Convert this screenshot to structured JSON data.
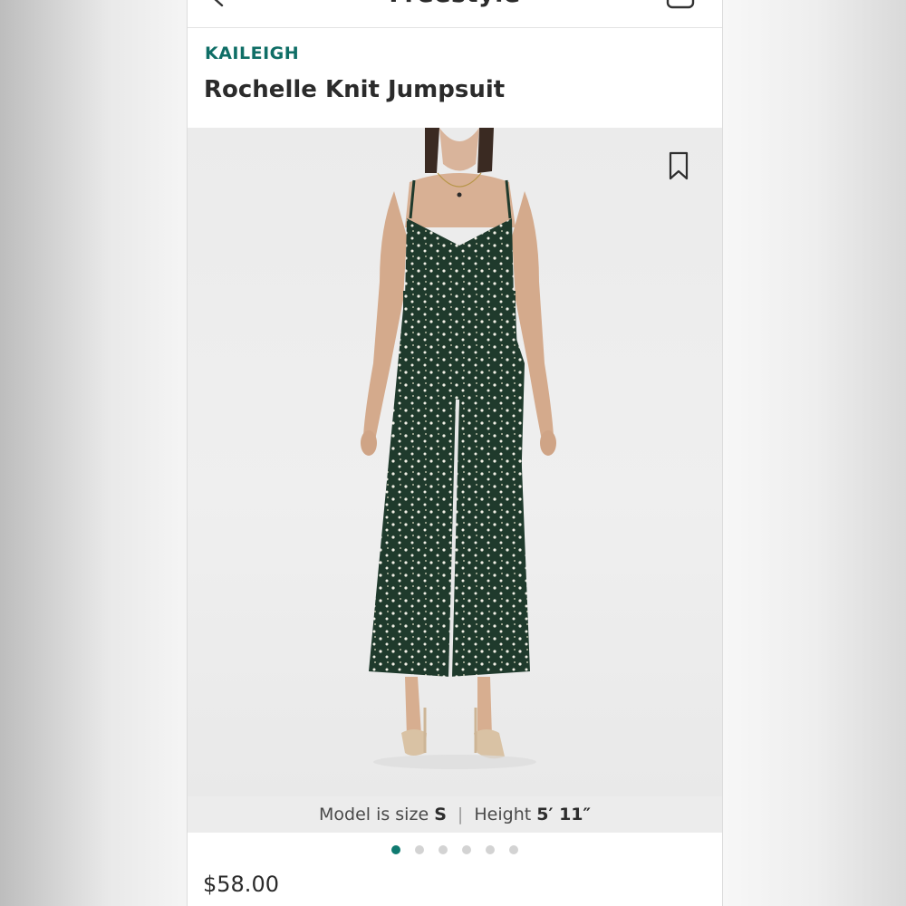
{
  "app": {
    "title": "Freestyle"
  },
  "product": {
    "brand": "KAILEIGH",
    "name": "Rochelle Knit Jumpsuit",
    "price": "$58.00"
  },
  "caption": {
    "model_size_label": "Model is size",
    "model_size_value": "S",
    "height_label": "Height",
    "height_value": "5′ 11″"
  },
  "gallery": {
    "image_count": 6,
    "active_index": 0
  },
  "colors": {
    "brand_teal": "#0f6e66",
    "active_dot": "#0f7a70",
    "jumpsuit_green": "#1f3a2c"
  },
  "icons": {
    "back": "chevron-left-icon",
    "cart": "cart-icon",
    "bookmark": "bookmark-icon"
  }
}
